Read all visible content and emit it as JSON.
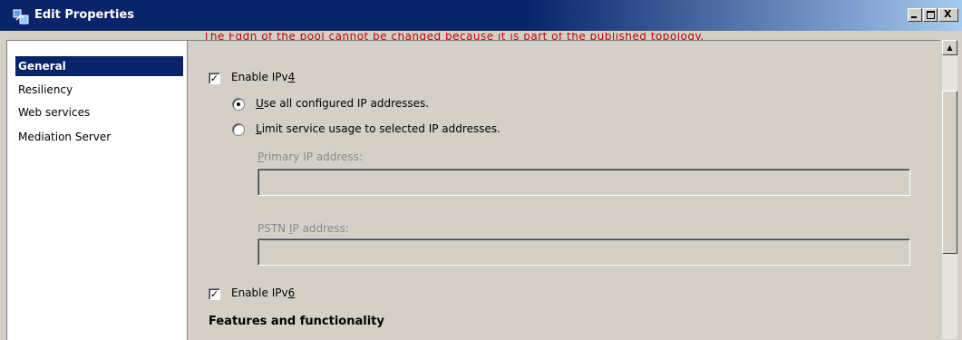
{
  "window": {
    "title": "Edit Properties",
    "controls": {
      "minimize": "_",
      "restore": "□",
      "close": "X"
    }
  },
  "nav": {
    "items": [
      {
        "label": "General",
        "selected": true
      },
      {
        "label": "Resiliency",
        "selected": false
      },
      {
        "label": "Web services",
        "selected": false
      },
      {
        "label": "Mediation Server",
        "selected": false
      }
    ]
  },
  "content": {
    "cutoff_text": "The Fqdn of the pool cannot be changed because it is part of the published topology.",
    "ipv4": {
      "pre": "Enable IPv",
      "accel": "4",
      "checked": true,
      "check_mark": "✓"
    },
    "use_all": {
      "accel": "U",
      "rest": "se all configured IP addresses.",
      "selected": true
    },
    "limit": {
      "accel": "L",
      "rest": "imit service usage to selected IP addresses.",
      "selected": false
    },
    "primary_ip": {
      "accel": "P",
      "rest": "rimary IP address:",
      "value": ""
    },
    "pstn_ip": {
      "pre": "PSTN ",
      "accel": "I",
      "rest": "P address:",
      "value": ""
    },
    "ipv6": {
      "pre": "Enable IPv",
      "accel": "6",
      "checked": true,
      "check_mark": "✓"
    },
    "features_heading": "Features and functionality"
  },
  "scrollbar": {
    "up_arrow": "▲"
  },
  "colors": {
    "titlebar": "#0a246a",
    "selection": "#0a246a",
    "warning_text": "#cc0000",
    "face": "#d4d0c8"
  }
}
